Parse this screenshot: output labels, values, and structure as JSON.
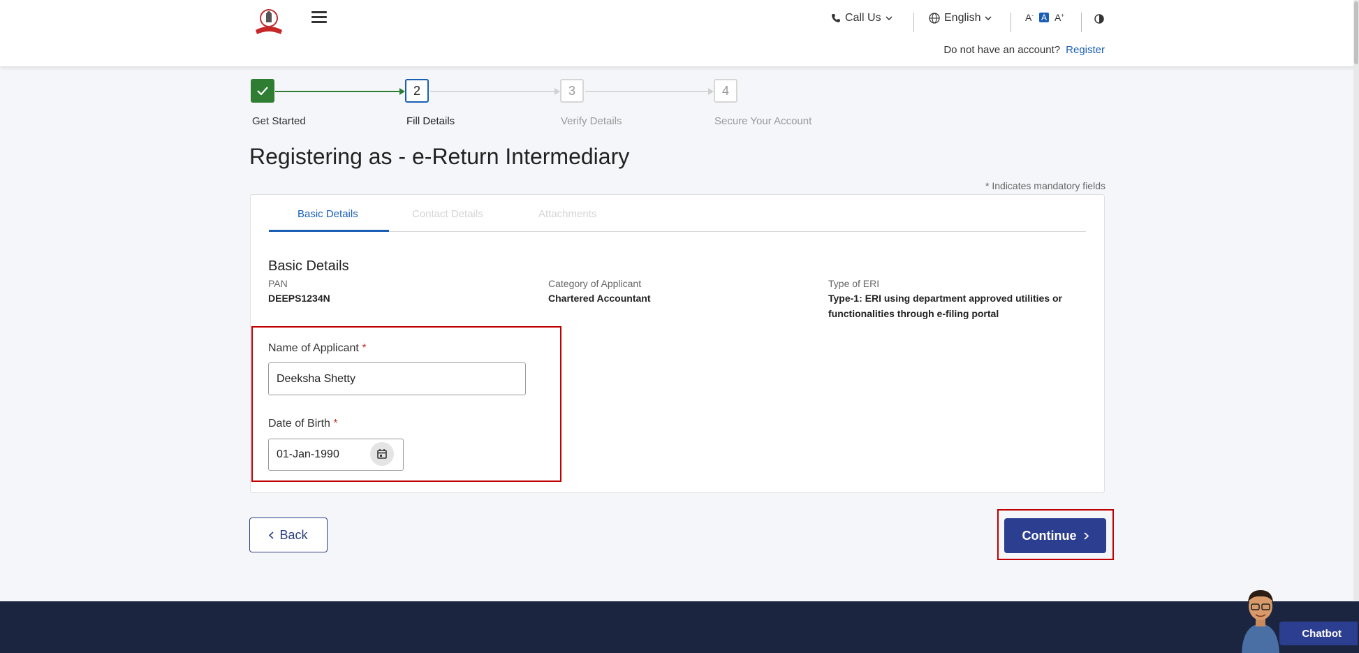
{
  "header": {
    "call_us": "Call Us",
    "language": "English",
    "font_decrease": "A",
    "font_default": "A",
    "font_increase": "A",
    "no_account_text": "Do not have an account?",
    "register_link": "Register"
  },
  "stepper": {
    "steps": [
      {
        "number": "1",
        "label": "Get Started",
        "status": "completed"
      },
      {
        "number": "2",
        "label": "Fill Details",
        "status": "active"
      },
      {
        "number": "3",
        "label": "Verify Details",
        "status": "pending"
      },
      {
        "number": "4",
        "label": "Secure Your Account",
        "status": "pending"
      }
    ]
  },
  "page": {
    "title": "Registering as -  e-Return Intermediary",
    "mandatory_note": "* Indicates mandatory fields"
  },
  "tabs": [
    {
      "label": "Basic Details",
      "active": true
    },
    {
      "label": "Contact Details",
      "active": false
    },
    {
      "label": "Attachments",
      "active": false
    }
  ],
  "basic_details": {
    "section_title": "Basic Details",
    "pan_label": "PAN",
    "pan_value": "DEEPS1234N",
    "category_label": "Category of Applicant",
    "category_value": "Chartered Accountant",
    "eri_type_label": "Type of ERI",
    "eri_type_value_line1": "Type-1: ERI using department approved utilities or",
    "eri_type_value_line2": "functionalities through e-filing portal"
  },
  "form": {
    "name_label": "Name of Applicant",
    "name_value": "Deeksha Shetty",
    "dob_label": "Date of Birth",
    "dob_value": "01-Jan-1990",
    "required_marker": "*"
  },
  "actions": {
    "back_label": "Back",
    "continue_label": "Continue"
  },
  "chatbot": {
    "label": "Chatbot"
  },
  "colors": {
    "primary": "#2c3e8f",
    "completed": "#2e7d32",
    "link": "#1a5fb4",
    "highlight": "#c00000"
  }
}
